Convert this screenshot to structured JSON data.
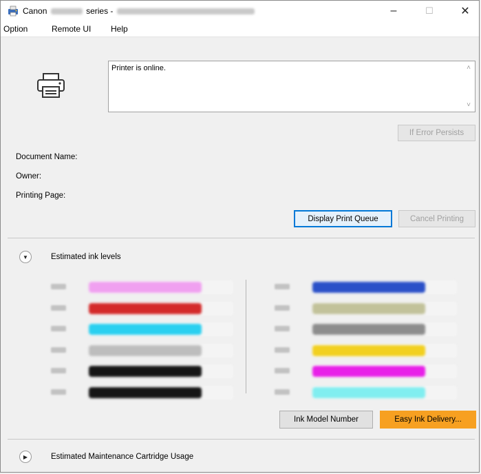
{
  "window": {
    "title_brand": "Canon",
    "title_series": "series -",
    "minimize": "–",
    "maximize": "☐",
    "close": "✕"
  },
  "menu": {
    "items": [
      {
        "label": "Option"
      },
      {
        "label": "Remote UI"
      },
      {
        "label": "Help"
      }
    ]
  },
  "status": {
    "message": "Printer is online.",
    "scroll_up": "˄",
    "scroll_down": "˅"
  },
  "buttons": {
    "if_error_persists": "If Error Persists",
    "display_print_queue": "Display Print Queue",
    "cancel_printing": "Cancel Printing",
    "ink_model_number": "Ink Model Number",
    "easy_ink_delivery": "Easy Ink Delivery..."
  },
  "job_info": {
    "document_name_label": "Document Name:",
    "owner_label": "Owner:",
    "printing_page_label": "Printing Page:"
  },
  "sections": {
    "ink_levels": {
      "label": "Estimated ink levels",
      "expander": "▼"
    },
    "maintenance": {
      "label": "Estimated Maintenance Cartridge Usage",
      "expander": "▶"
    }
  },
  "inks": {
    "left": [
      {
        "color": "#f0a0f0",
        "level": 0.78
      },
      {
        "color": "#d42a2a",
        "level": 0.78
      },
      {
        "color": "#2ad0f0",
        "level": 0.78
      },
      {
        "color": "#bdbdbd",
        "level": 0.78
      },
      {
        "color": "#151515",
        "level": 0.78
      },
      {
        "color": "#151515",
        "level": 0.78
      }
    ],
    "right": [
      {
        "color": "#2a50c8",
        "level": 0.78
      },
      {
        "color": "#c2c29a",
        "level": 0.78
      },
      {
        "color": "#8d8d8d",
        "level": 0.78
      },
      {
        "color": "#f2d020",
        "level": 0.78
      },
      {
        "color": "#e820e8",
        "level": 0.78
      },
      {
        "color": "#80eef0",
        "level": 0.78
      }
    ]
  },
  "colors": {
    "accent_focus": "#0078d7",
    "delivery_button": "#f7a021"
  }
}
